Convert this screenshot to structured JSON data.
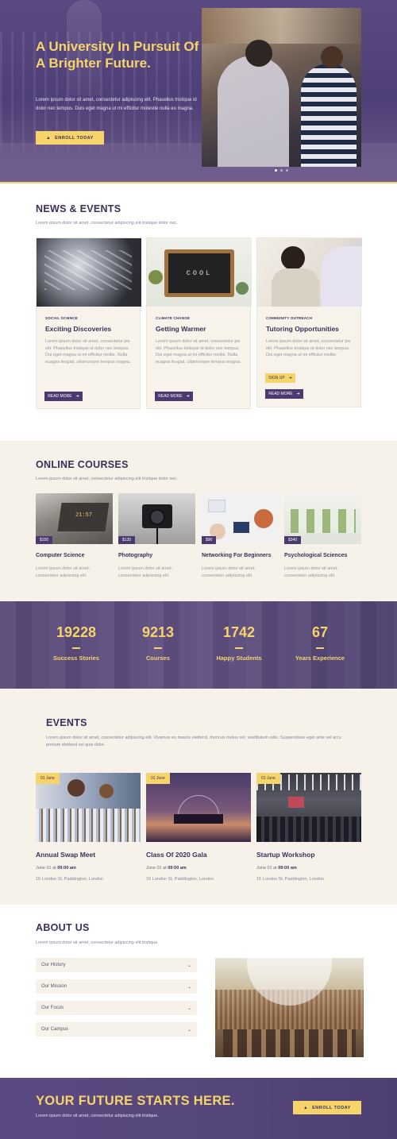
{
  "hero": {
    "title": "A University In Pursuit Of A Brighter Future.",
    "text": "Lorem ipsum dolor sit amet, consectetur adipiscing elit. Phasellus tristique id dolor nec tempus. Duis eget magna ut mi efficitur molestie nulla eu magna.",
    "enroll_label": "ENROLL TODAY",
    "enroll_icon": "graduation-cap-icon",
    "slide_count": 3,
    "active_slide": 1
  },
  "news": {
    "title": "NEWS & EVENTS",
    "subtitle": "Lorem ipsum dolor sit amet, consectetur adipiscing elit tristique dolor nec.",
    "cards": [
      {
        "category": "SOCIAL SCIENCE",
        "title": "Exciting Discoveries",
        "text": "Lorem ipsum dolor sit amet, consectetur pis elit. Phasellus tristique id dolor nec tempus. Dui eget magna ut mi efficitur moltie. Nulla euagna feugiat, ullamcorper tempus magna.",
        "button": "READ MORE"
      },
      {
        "category": "CLIMATE CHANGE",
        "title": "Getting Warmer",
        "image_text": "COOL",
        "text": "Lorem ipsum dolor sit amet, consectetur pis elit. Phasellus tristique id dolor nec tempus. Dui eget magna ut mi efficitur moltie. Nulla euagna feugiat, ullamcorper tempus magna.",
        "button": "READ MORE"
      },
      {
        "category": "COMMUNITY OUTREACH",
        "title": "Tutoring Opportunities",
        "text": "Lorem ipsum dolor sit amet, consectetur pis elit. Phasellus tristique id dolor nec tempus. Dui eget magna ut mi efficitur moltie.",
        "signup": "SIGN UP",
        "button": "READ MORE"
      }
    ]
  },
  "courses": {
    "title": "ONLINE COURSES",
    "subtitle": "Lorem ipsum dolor sit amet, consectetur adipiscing elit tristique dolor nec.",
    "items": [
      {
        "price": "$150",
        "title": "Computer Science",
        "text": "Lorem ipsum dolor sit amet, consectetur adipiscing elit.",
        "image_text": "21:57"
      },
      {
        "price": "$135",
        "title": "Photography",
        "text": "Lorem ipsum dolor sit amet, consectetur adipiscing elit."
      },
      {
        "price": "$90",
        "title": "Networking For Beginners",
        "text": "Lorem ipsum dolor sit amet, consectetur adipiscing elit."
      },
      {
        "price": "$340",
        "title": "Psychological Sciences",
        "text": "Lorem ipsum dolor sit amet, consectetur adipiscing elit."
      }
    ]
  },
  "stats": [
    {
      "number": "19228",
      "label": "Success Stories"
    },
    {
      "number": "9213",
      "label": "Courses"
    },
    {
      "number": "1742",
      "label": "Happy Students"
    },
    {
      "number": "67",
      "label": "Years Experience"
    }
  ],
  "events": {
    "title": "EVENTS",
    "subtitle": "Lorem ipsum dolor sit amet, consectetur adipiscing elit. Vivamus eu mauris eleifend, rhoncus metus vel, vestibulum odio. Suspendisse eget ante vel arcu pretium eleifend vel quis dolor.",
    "items": [
      {
        "date": "01 June",
        "title": "Annual Swap Meet",
        "day": "June 01 at",
        "time": "09:00 am",
        "location": "16 London St, Paddington, London"
      },
      {
        "date": "01 June",
        "title": "Class Of 2020 Gala",
        "day": "June 01 at",
        "time": "09:00 am",
        "location": "16 London St, Paddington, London"
      },
      {
        "date": "01 June",
        "title": "Startup Workshop",
        "day": "June 01 at",
        "time": "09:00 am",
        "location": "16 London St, Paddington, London"
      }
    ]
  },
  "about": {
    "title": "ABOUT US",
    "subtitle": "Lorem ipsum dolor sit amet, consectetur adipiscing elit tristique.",
    "accordion": [
      "Our History",
      "Our Mission",
      "Our Focus",
      "Our Campus"
    ]
  },
  "cta": {
    "title": "YOUR FUTURE STARTS HERE.",
    "subtitle": "Lorem ipsum dolor sit amet, consectetur adipiscing elit tristique.",
    "button": "ENROLL TODAY"
  },
  "colors": {
    "brand_purple": "#4a3a6f",
    "accent_yellow": "#f6d46a",
    "cream": "#f6f2ea"
  }
}
